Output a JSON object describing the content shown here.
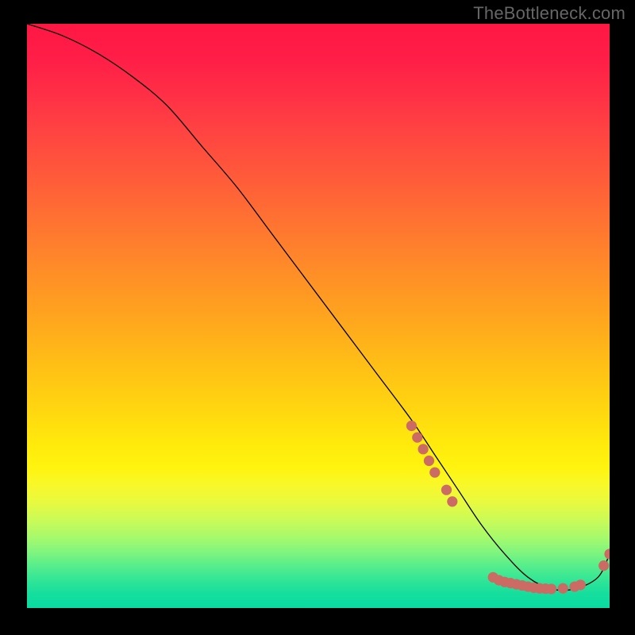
{
  "watermark": "TheBottleneck.com",
  "chart_data": {
    "type": "line",
    "title": "",
    "xlabel": "",
    "ylabel": "",
    "xlim": [
      0,
      100
    ],
    "ylim": [
      0,
      100
    ],
    "background": "red-yellow-green vertical gradient",
    "series": [
      {
        "name": "curve",
        "x": [
          0,
          6,
          12,
          18,
          24,
          30,
          36,
          42,
          48,
          54,
          60,
          66,
          70,
          74,
          78,
          82,
          86,
          90,
          94,
          98,
          100
        ],
        "y": [
          100,
          98,
          95,
          91,
          86,
          79,
          72,
          64,
          56,
          48,
          40,
          32,
          26,
          20,
          14,
          9,
          5,
          3,
          3,
          5,
          9
        ],
        "stroke": "#000000"
      }
    ],
    "markers": [
      {
        "name": "cluster-descent",
        "color": "#cc6b64",
        "points": [
          {
            "x": 66,
            "y": 31
          },
          {
            "x": 67,
            "y": 29
          },
          {
            "x": 68,
            "y": 27
          },
          {
            "x": 69,
            "y": 25
          },
          {
            "x": 70,
            "y": 23
          },
          {
            "x": 72,
            "y": 20
          },
          {
            "x": 73,
            "y": 18
          }
        ]
      },
      {
        "name": "cluster-bottom",
        "color": "#cc6b64",
        "points": [
          {
            "x": 80,
            "y": 5
          },
          {
            "x": 81,
            "y": 4.5
          },
          {
            "x": 82,
            "y": 4.2
          },
          {
            "x": 83,
            "y": 4
          },
          {
            "x": 84,
            "y": 3.8
          },
          {
            "x": 85,
            "y": 3.6
          },
          {
            "x": 86,
            "y": 3.4
          },
          {
            "x": 87,
            "y": 3.2
          },
          {
            "x": 88,
            "y": 3.1
          },
          {
            "x": 89,
            "y": 3.05
          },
          {
            "x": 90,
            "y": 3
          },
          {
            "x": 92,
            "y": 3.1
          },
          {
            "x": 94,
            "y": 3.4
          },
          {
            "x": 95,
            "y": 3.7
          }
        ]
      },
      {
        "name": "cluster-upturn",
        "color": "#cc6b64",
        "points": [
          {
            "x": 99,
            "y": 7
          },
          {
            "x": 100,
            "y": 9
          }
        ]
      }
    ],
    "label_on_curve": {
      "text": "",
      "x": 84,
      "y": 4
    }
  }
}
